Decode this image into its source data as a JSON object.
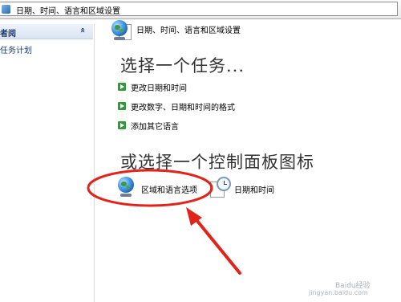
{
  "address_bar": {
    "path": "日期、时间、语言和区域设置"
  },
  "sidebar": {
    "header": "者阅",
    "chevron": "«",
    "item": "任务计划"
  },
  "header": {
    "title": "日期、时间、语言和区域设置"
  },
  "task_section": {
    "title": "选择一个任务...",
    "links": [
      {
        "label": "更改日期和时间"
      },
      {
        "label": "更改数字、日期和时间的格式"
      },
      {
        "label": "添加其它语言"
      }
    ]
  },
  "control_panel_section": {
    "title": "或选择一个控制面板图标",
    "icons": [
      {
        "label": "区域和语言选项",
        "icon": "globe-icon"
      },
      {
        "label": "日期和时间",
        "icon": "clock-icon"
      }
    ]
  },
  "annotation": {
    "ellipse_color": "#e2231a",
    "arrow_color": "#e2231a"
  },
  "watermark": {
    "line1": "Baidu经验",
    "line2": "jingyan.baidu.com"
  }
}
